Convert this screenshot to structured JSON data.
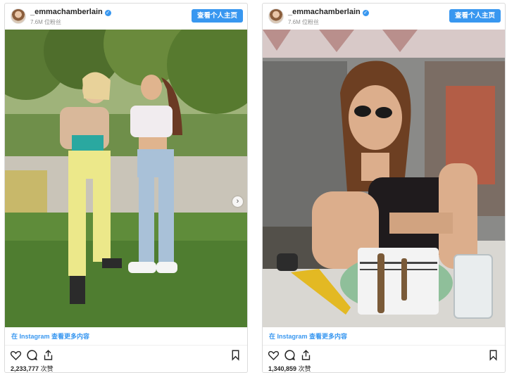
{
  "posts": [
    {
      "username": "_emmachamberlain",
      "verified_glyph": "✓",
      "followers": "7.6M 位粉丝",
      "profile_button": "查看个人主页",
      "next_glyph": "›",
      "more_link": "在 Instagram 查看更多内容",
      "likes_count": "2,233,777",
      "likes_label": "次赞",
      "image_semantics": "outdoor-photo-two-friends-posing"
    },
    {
      "username": "_emmachamberlain",
      "verified_glyph": "✓",
      "followers": "7.6M 位粉丝",
      "profile_button": "查看个人主页",
      "more_link": "在 Instagram 查看更多内容",
      "likes_count": "1,340,859",
      "likes_label": "次赞",
      "image_semantics": "cafe-photo-woman-sunglasses"
    }
  ],
  "icons": {
    "like": "heart-icon",
    "comment": "comment-bubble-icon",
    "share": "share-upload-icon",
    "save": "bookmark-icon",
    "verified": "verified-badge-icon",
    "next": "chevron-right-icon"
  },
  "colors": {
    "accent_blue": "#3897f0",
    "border": "#dbdbdb",
    "text": "#262626",
    "muted": "#8e8e8e"
  }
}
